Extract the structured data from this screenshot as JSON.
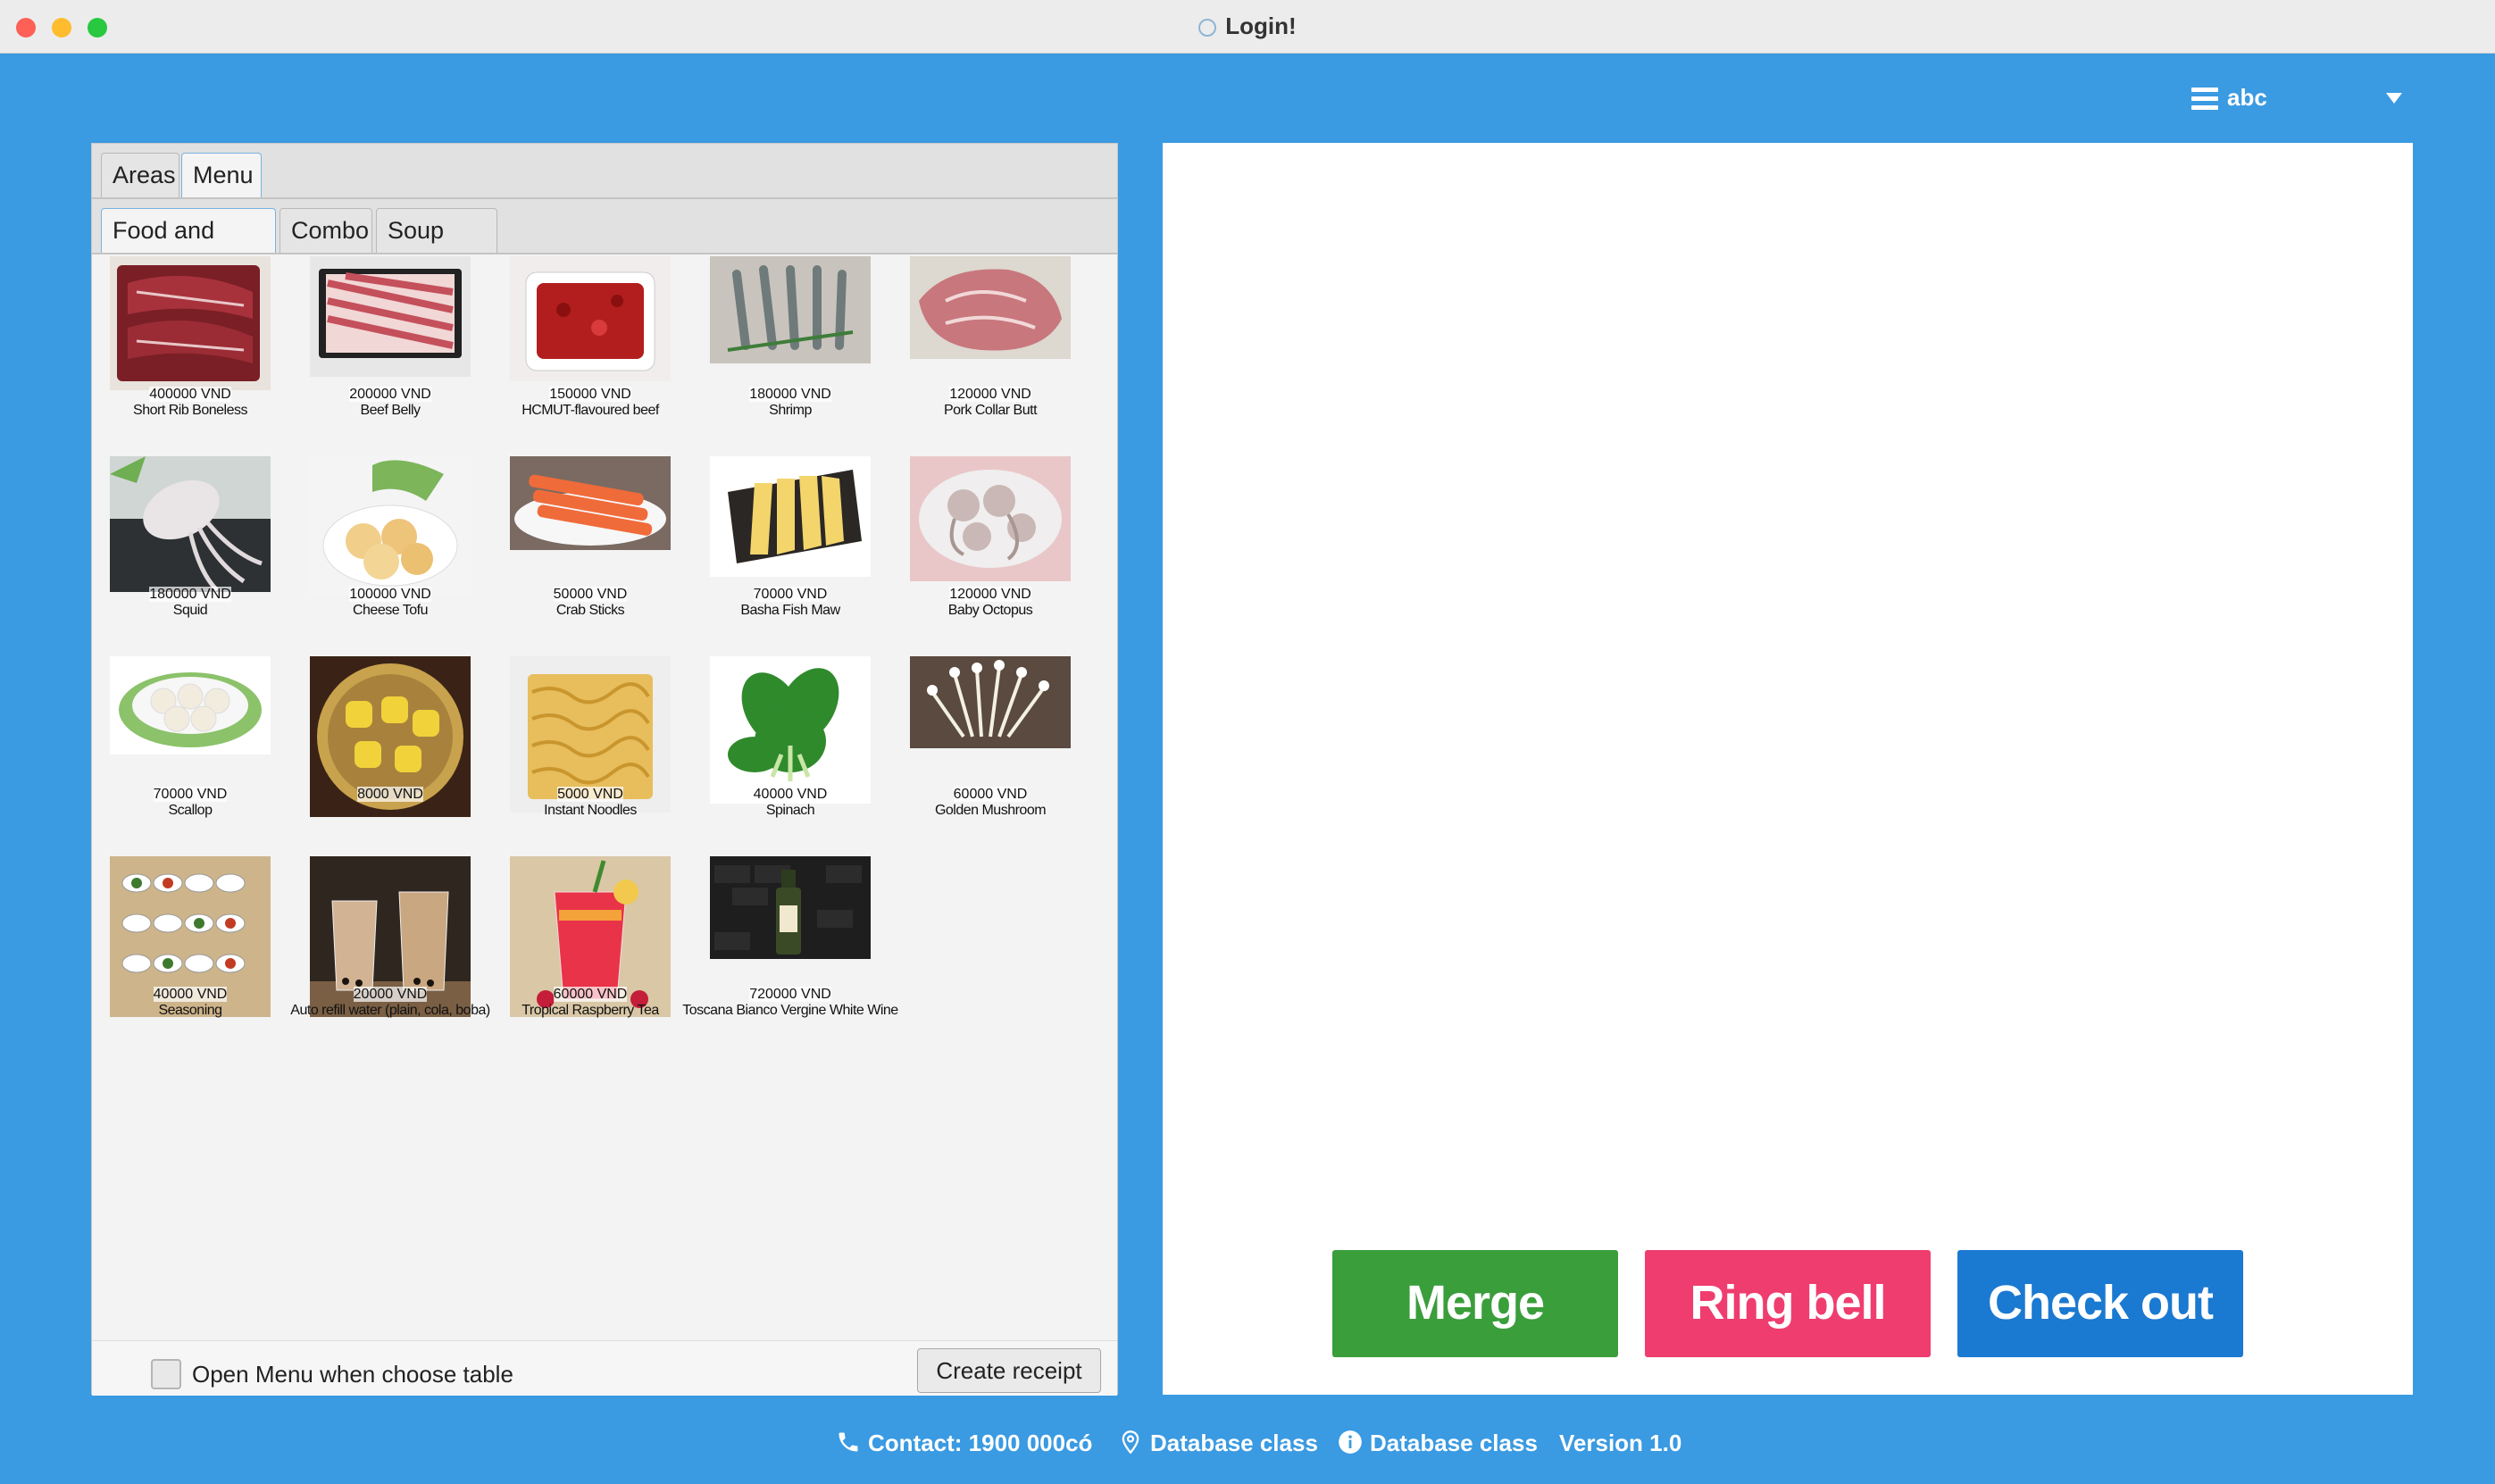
{
  "window": {
    "title": "Login!"
  },
  "user": {
    "name": "abc"
  },
  "tabs_top": [
    {
      "label": "Areas"
    },
    {
      "label": "Menu"
    }
  ],
  "tabs_menu": [
    {
      "label": "Food and Drink"
    },
    {
      "label": "Combo"
    },
    {
      "label": "Soup base"
    }
  ],
  "menu_items": [
    {
      "price": "400000 VND",
      "name": "Short Rib Boneless"
    },
    {
      "price": "200000 VND",
      "name": "Beef Belly"
    },
    {
      "price": "150000 VND",
      "name": "HCMUT-flavoured beef"
    },
    {
      "price": "180000 VND",
      "name": "Shrimp"
    },
    {
      "price": "120000 VND",
      "name": "Pork Collar Butt"
    },
    {
      "price": "180000 VND",
      "name": "Squid"
    },
    {
      "price": "100000 VND",
      "name": "Cheese Tofu"
    },
    {
      "price": "50000 VND",
      "name": "Crab Sticks"
    },
    {
      "price": "70000 VND",
      "name": "Basha Fish Maw"
    },
    {
      "price": "120000 VND",
      "name": "Baby Octopus"
    },
    {
      "price": "70000 VND",
      "name": "Scallop"
    },
    {
      "price": "8000 VND",
      "name": ""
    },
    {
      "price": "5000 VND",
      "name": "Instant Noodles"
    },
    {
      "price": "40000 VND",
      "name": "Spinach"
    },
    {
      "price": "60000 VND",
      "name": "Golden Mushroom"
    },
    {
      "price": "40000 VND",
      "name": "Seasoning"
    },
    {
      "price": "20000 VND",
      "name": "Auto refill water (plain, cola, boba)"
    },
    {
      "price": "60000 VND",
      "name": "Tropical Raspberry Tea"
    },
    {
      "price": "720000 VND",
      "name": "Toscana Bianco Vergine White Wine"
    }
  ],
  "bottom": {
    "checkbox_label": "Open Menu when choose table",
    "create_receipt": "Create receipt"
  },
  "actions": {
    "merge": "Merge",
    "ring_bell": "Ring bell",
    "check_out": "Check out"
  },
  "footer": {
    "contact": "Contact: 1900 000có",
    "location": "Database class",
    "info": "Database class",
    "version": "Version 1.0"
  },
  "colors": {
    "background": "#3a9ae2",
    "merge": "#3a9e3b",
    "ring_bell": "#ef3d6f",
    "check_out": "#1a79d1"
  }
}
